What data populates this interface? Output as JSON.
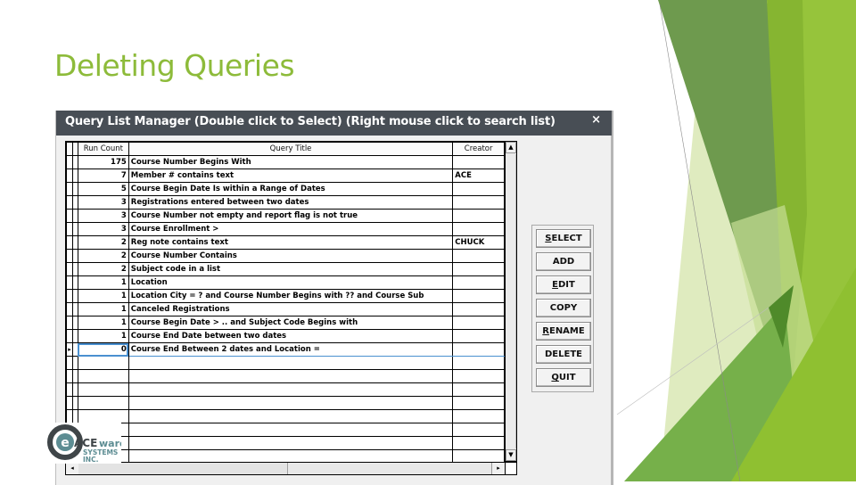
{
  "slide": {
    "title": "Deleting Queries",
    "accent_color": "#8dbb3a"
  },
  "window": {
    "title": "Query List Manager (Double click to Select) (Right mouse click to search list)",
    "close_glyph": "×",
    "close_icon": "close-icon"
  },
  "grid": {
    "columns": [
      "Run Count",
      "Query Title",
      "Creator"
    ],
    "rows": [
      {
        "run_count": "175",
        "title": "Course Number Begins With",
        "creator": ""
      },
      {
        "run_count": "7",
        "title": "Member # contains text",
        "creator": "ACE"
      },
      {
        "run_count": "5",
        "title": "Course Begin Date Is within a Range of Dates",
        "creator": ""
      },
      {
        "run_count": "3",
        "title": "Registrations entered between two dates",
        "creator": ""
      },
      {
        "run_count": "3",
        "title": "Course Number not empty and report flag is not true",
        "creator": ""
      },
      {
        "run_count": "3",
        "title": "Course Enrollment >",
        "creator": ""
      },
      {
        "run_count": "2",
        "title": "Reg note contains text",
        "creator": "CHUCK"
      },
      {
        "run_count": "2",
        "title": "Course Number Contains",
        "creator": ""
      },
      {
        "run_count": "2",
        "title": "Subject code in a list",
        "creator": ""
      },
      {
        "run_count": "1",
        "title": "Location",
        "creator": ""
      },
      {
        "run_count": "1",
        "title": "Location City = ? and Course Number Begins with ?? and Course Sub",
        "creator": ""
      },
      {
        "run_count": "1",
        "title": "Canceled Registrations",
        "creator": ""
      },
      {
        "run_count": "1",
        "title": "Course Begin Date > .. and Subject Code Begins with",
        "creator": ""
      },
      {
        "run_count": "1",
        "title": "Course End Date between two dates",
        "creator": ""
      },
      {
        "run_count": "0",
        "title": "Course End Between 2 dates and Location =",
        "creator": "",
        "selected": true
      }
    ],
    "empty_rows": 9,
    "row_indicator_glyph": "▸",
    "scroll_up_glyph": "▲",
    "scroll_down_glyph": "▼",
    "scroll_left_glyph": "◂",
    "scroll_right_glyph": "▸"
  },
  "buttons": [
    {
      "label": "SELECT",
      "mnemonic_index": 0
    },
    {
      "label": "ADD",
      "mnemonic_index": -1
    },
    {
      "label": "EDIT",
      "mnemonic_index": 0
    },
    {
      "label": "COPY",
      "mnemonic_index": -1
    },
    {
      "label": "RENAME",
      "mnemonic_index": 0
    },
    {
      "label": "DELETE",
      "mnemonic_index": -1
    },
    {
      "label": "QUIT",
      "mnemonic_index": 0
    }
  ],
  "logo": {
    "brand_main": "ACE",
    "brand_suffix": "ware",
    "line2": "SYSTEMS",
    "line3": "INC.",
    "letter": "e"
  }
}
